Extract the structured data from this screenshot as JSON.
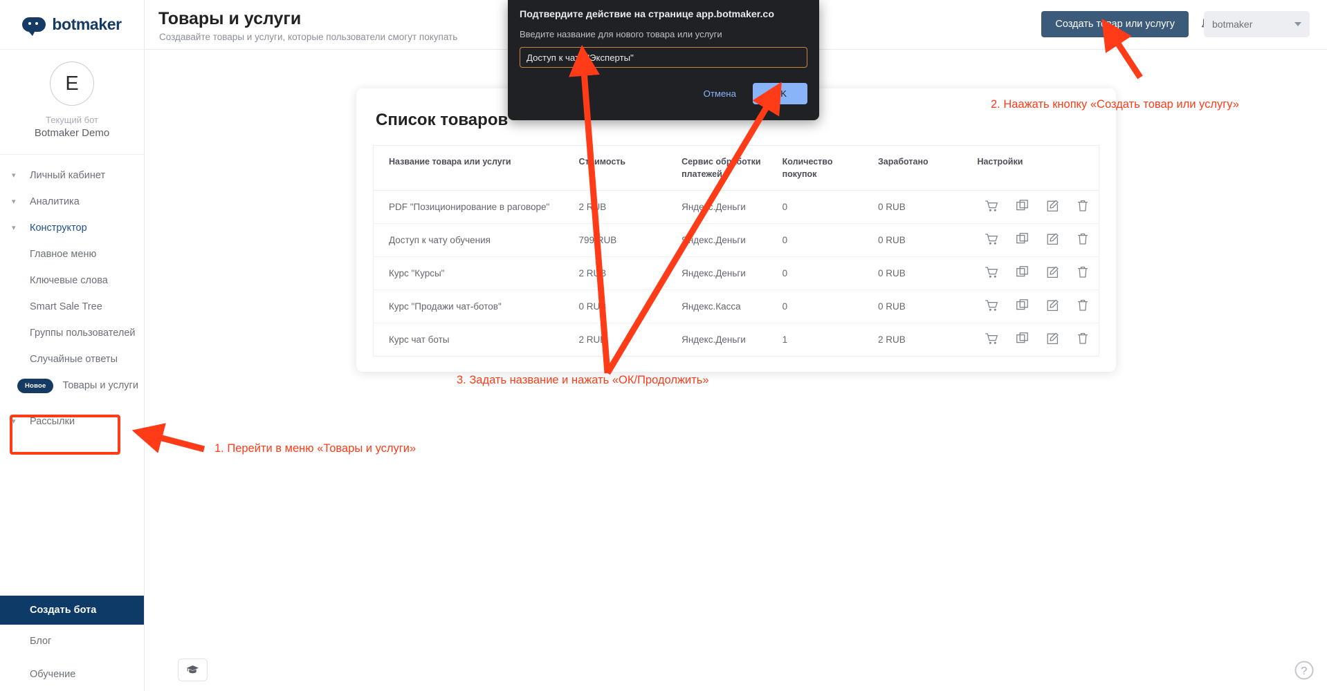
{
  "brand": {
    "name": "botmaker",
    "logo_icon": "chat-bubble-icon"
  },
  "sidebar": {
    "bot": {
      "avatar_letter": "E",
      "label": "Текущий бот",
      "name": "Botmaker Demo"
    },
    "groups": [
      {
        "label": "Личный кабинет",
        "active": false
      },
      {
        "label": "Аналитика",
        "active": false
      },
      {
        "label": "Конструктор",
        "active": true
      }
    ],
    "items": [
      {
        "label": "Главное меню"
      },
      {
        "label": "Ключевые слова"
      },
      {
        "label": "Smart Sale Tree"
      },
      {
        "label": "Группы пользователей"
      },
      {
        "label": "Случайные ответы"
      }
    ],
    "highlighted_item": {
      "badge": "Новое",
      "label": "Товары и услуги"
    },
    "group_last": {
      "label": "Рассылки"
    },
    "footer": {
      "cta": "Создать бота",
      "links": [
        {
          "label": "Блог"
        },
        {
          "label": "Обучение"
        }
      ]
    }
  },
  "header": {
    "title": "Товары и услуги",
    "subtitle": "Создавайте товары и услуги, которые пользователи смогут покупать",
    "create_button": "Создать товар или услугу",
    "bell_icon": "bell-icon",
    "account": {
      "name": "botmaker",
      "caret_icon": "chevron-down-icon"
    }
  },
  "main": {
    "card_title": "Список товаров",
    "table": {
      "columns": [
        "Название товара или услуги",
        "Стоимость",
        "Сервис обработки платежей",
        "Количество покупок",
        "Заработано",
        "Настройки"
      ],
      "rows": [
        {
          "name": "PDF \"Позиционирование в раговоре\"",
          "price": "2 RUB",
          "service": "Яндекс.Деньги",
          "qty": "0",
          "earned": "0 RUB"
        },
        {
          "name": "Доступ к чату обучения",
          "price": "799 RUB",
          "service": "Яндекс.Деньги",
          "qty": "0",
          "earned": "0 RUB"
        },
        {
          "name": "Курс \"Курсы\"",
          "price": "2 RUB",
          "service": "Яндекс.Деньги",
          "qty": "0",
          "earned": "0 RUB"
        },
        {
          "name": "Курс \"Продажи чат-ботов\"",
          "price": "0 RUB",
          "service": "Яндекс.Касса",
          "qty": "0",
          "earned": "0 RUB"
        },
        {
          "name": "Курс чат боты",
          "price": "2 RUB",
          "service": "Яндекс.Деньги",
          "qty": "1",
          "earned": "2 RUB"
        }
      ],
      "action_icons": [
        "cart-icon",
        "copy-icon",
        "edit-icon",
        "trash-icon"
      ]
    }
  },
  "dialog": {
    "title": "Подтвердите действие на странице  app.botmaker.co",
    "message": "Введите название для нового товара или услуги",
    "input_value": "Доступ к чату \"Эксперты\"",
    "input_placeholder": "",
    "cancel_label": "Отмена",
    "ok_label": "OK"
  },
  "annotations": {
    "step1": "1. Перейти в меню «Товары и услуги»",
    "step2": "2. Наажать кнопку «Создать товар или услугу»",
    "step3": "3. Задать название и нажать «ОК/Продолжить»",
    "color": "#ff3b18"
  },
  "floating": {
    "education_icon": "graduation-cap-icon",
    "help_icon": "question-mark-circle-icon"
  },
  "colors": {
    "brand_navy": "#153a63",
    "accent_blue": "#1d4f91",
    "button_slate": "#3c5a7a",
    "dialog_bg": "#202124",
    "dialog_accent": "#8ab4f8",
    "annotation_red": "#ff3b18"
  }
}
